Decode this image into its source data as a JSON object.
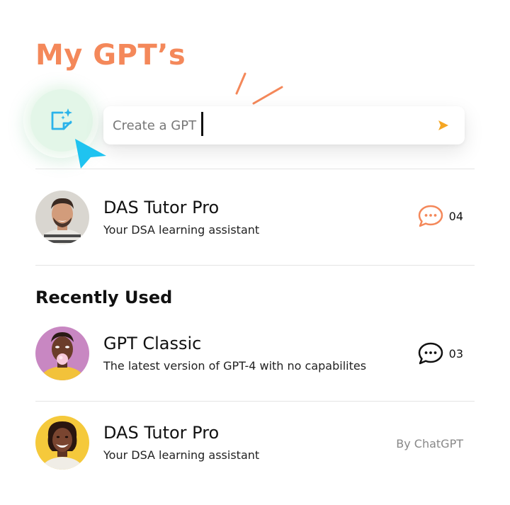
{
  "header": {
    "title": "My GPT’s"
  },
  "create": {
    "placeholder": "Create a GPT"
  },
  "my_gpts": [
    {
      "name": "DAS Tutor Pro",
      "description": "Your DSA learning assistant",
      "chat_count": "04",
      "chat_icon": "chat-bubble-icon",
      "chat_icon_color": "#f4885a"
    }
  ],
  "recently_used": {
    "title": "Recently Used",
    "items": [
      {
        "name": "GPT Classic",
        "description": "The latest version of GPT-4 with no capabilites",
        "chat_count": "03",
        "chat_icon": "chat-bubble-icon",
        "chat_icon_color": "#111111"
      },
      {
        "name": "DAS Tutor Pro",
        "description": "Your DSA learning assistant",
        "by": "By ChatGPT"
      }
    ]
  },
  "colors": {
    "accent": "#f4885a",
    "send_arrow": "#f5a623",
    "cursor": "#1fc3f0",
    "create_icon": "#2bb3ea",
    "icon_circle": "#e3f6e8"
  }
}
